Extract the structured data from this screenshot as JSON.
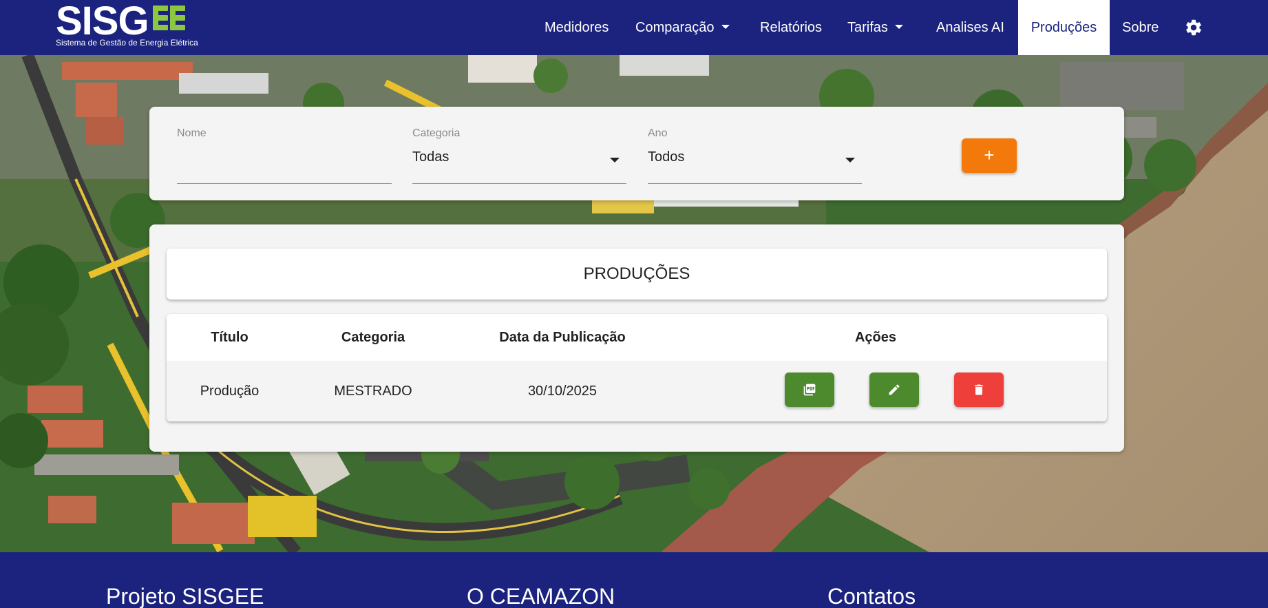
{
  "app": {
    "logo_text": "SISG",
    "logo_subtitle": "Sistema de Gestão de Energia Elétrica"
  },
  "nav": {
    "items": [
      {
        "label": "Medidores"
      },
      {
        "label": "Comparação"
      },
      {
        "label": "Relatórios"
      },
      {
        "label": "Tarifas"
      },
      {
        "label": "Analises AI"
      },
      {
        "label": "Produções"
      },
      {
        "label": "Sobre"
      }
    ],
    "active": "Produções",
    "settings_icon": "gear-icon"
  },
  "filters": {
    "name": {
      "label": "Nome",
      "value": ""
    },
    "category": {
      "label": "Categoria",
      "value": "Todas"
    },
    "year": {
      "label": "Ano",
      "value": "Todos"
    },
    "add_label": "+"
  },
  "main": {
    "title": "PRODUÇÕES",
    "columns": [
      "Título",
      "Categoria",
      "Data da Publicação",
      "Ações"
    ],
    "rows": [
      {
        "title": "Produção",
        "category": "MESTRADO",
        "date": "30/10/2025"
      }
    ],
    "actions": [
      {
        "icon": "pdf-icon",
        "color": "#4d8a2e"
      },
      {
        "icon": "pencil-icon",
        "color": "#4d8a2e"
      },
      {
        "icon": "trash-icon",
        "color": "#ef3f3a"
      }
    ]
  },
  "footer": {
    "columns": [
      "Projeto SISGEE",
      "O CEAMAZON",
      "Contatos"
    ]
  },
  "colors": {
    "primary": "#1b237e",
    "accent": "#f37a0a",
    "success": "#4d8a2e",
    "danger": "#ef3f3a",
    "logo_green": "#8dc63f"
  }
}
